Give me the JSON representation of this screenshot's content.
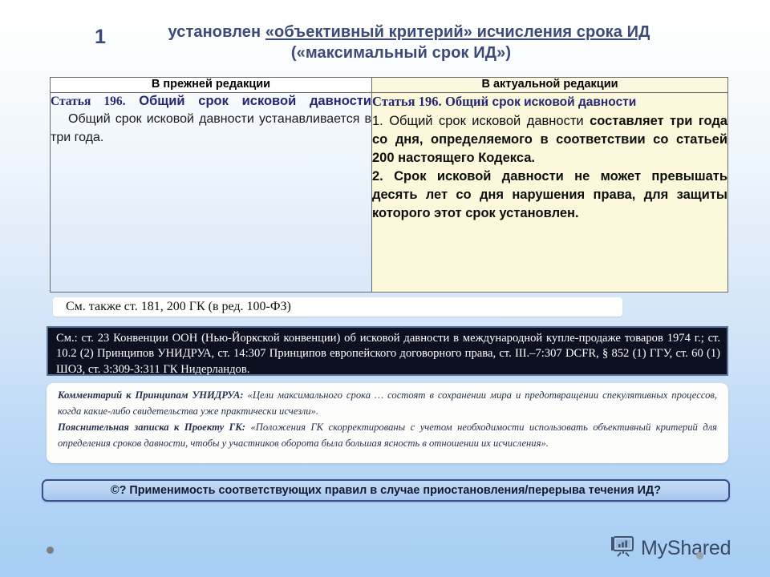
{
  "slide": {
    "number": "1",
    "title_line1_prefix": "установлен ",
    "title_line1_underlined": "«объективный критерий» исчисления срока ИД",
    "title_line2": "(«максимальный срок ИД»)"
  },
  "table": {
    "headers": {
      "old": "В прежней редакции",
      "new": "В актуальной редакции"
    },
    "old_edition": {
      "article_label": "Статья 196.",
      "article_title": "Общий срок исковой давности",
      "paragraph": "Общий срок исковой давности устанавливается в три года."
    },
    "new_edition": {
      "article_label": "Статья 196.",
      "article_title": "Общий срок исковой давности",
      "clause_1_number": "1.",
      "clause_1_plain": "Общий срок исковой давности",
      "clause_1_bold": "составляет три года со дня, определяемого в соответствии со статьей 200 настоящего Кодекса.",
      "clause_2_number": "2.",
      "clause_2_bold": "Срок исковой давности не может превышать десять лет со дня нарушения права, для защиты которого этот срок установлен."
    }
  },
  "see_also": {
    "text": "См. также ст. 181, 200 ГК (в ред. 100-ФЗ)"
  },
  "citation_box": {
    "text": "См.: ст. 23 Конвенции ООН (Нью-Йоркской конвенции) об исковой давности в международной купле-продаже товаров 1974 г.; ст. 10.2 (2) Принципов УНИДРУА, ст. 14:307 Принципов европейского договорного права, ст. III.–7:307 DCFR, § 852 (1) ГГУ, ст. 60 (1) ШОЗ, ст. 3:309-3:311 ГК Нидерландов."
  },
  "commentary": {
    "block1_label": "Комментарий к Принципам УНИДРУА:",
    "block1_text": " «Цели максимального срока … состоят в сохранении мира и предотвращении спекулятивных процессов, когда какие-либо свидетельства уже практически исчезли».",
    "block2_label": "Пояснительная записка к Проекту ГК:",
    "block2_text": " «Положения ГК скорректированы с учетом необходимости использовать объективный критерий для определения сроков давности, чтобы у участников оборота была большая ясность в отношении их исчисления»."
  },
  "question_bar": {
    "text": "©? Применимость соответствующих правил в случае приостановления/перерыва течения ИД?"
  },
  "watermark": {
    "text": "MyShared",
    "icon": "presentation-chart-icon"
  },
  "colors": {
    "title": "#3c4a78",
    "article_heading": "#262673",
    "new_cell_bg": "#fcf8dc",
    "dark_box_bg": "#0d1020",
    "dark_box_border": "#5c7296",
    "question_bar_border": "#3b4f8a"
  }
}
